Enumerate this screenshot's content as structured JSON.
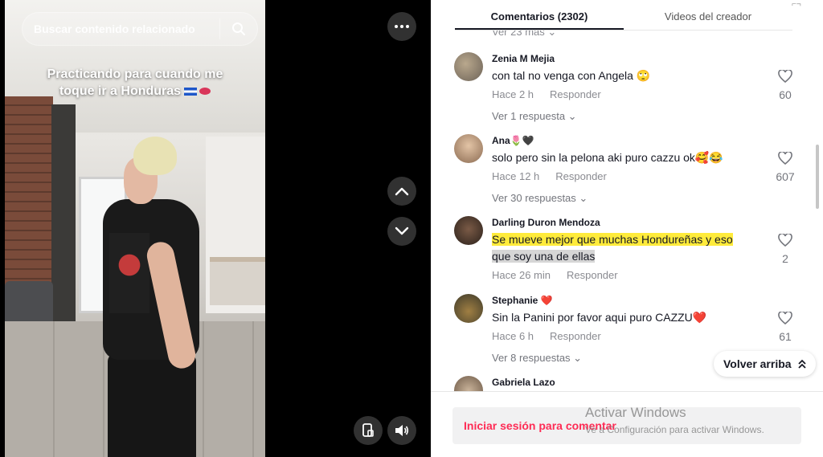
{
  "search": {
    "placeholder": "Buscar contenido relacionado",
    "icon": "search-icon"
  },
  "video": {
    "caption_line1": "Practicando para cuando me",
    "caption_line2": "toque ir a Honduras",
    "emoji": [
      "honduras-flag",
      "lips"
    ]
  },
  "controls": {
    "more": "more-icon",
    "up": "chevron-up-icon",
    "down": "chevron-down-icon",
    "device": "device-icon",
    "volume": "volume-icon"
  },
  "tabs": [
    {
      "label": "Comentarios (2302)",
      "active": true
    },
    {
      "label": "Videos del creador",
      "active": false
    }
  ],
  "partial_prev": "Ver 23 más",
  "comments": [
    {
      "user": "Zenia M Mejia",
      "text": "con tal no venga con Angela 🙄",
      "time": "Hace 2 h",
      "reply": "Responder",
      "likes": "60",
      "replies": "Ver 1 respuesta"
    },
    {
      "user": "Ana🌷🖤",
      "text": "solo pero sin la pelona aki puro cazzu ok🥰😂",
      "time": "Hace 12 h",
      "reply": "Responder",
      "likes": "607",
      "replies": "Ver 30 respuestas"
    },
    {
      "user": "Darling Duron Mendoza",
      "text_highlight": "Se mueve mejor que muchas Hondureñas y eso",
      "text_grey": "que soy una de ellas",
      "time": "Hace 26 min",
      "reply": "Responder",
      "likes": "2"
    },
    {
      "user": "Stephanie ❤️",
      "text": "Sin la Panini por favor aqui puro CAZZU❤️",
      "time": "Hace 6 h",
      "reply": "Responder",
      "likes": "61",
      "replies": "Ver 8 respuestas"
    },
    {
      "user": "Gabriela Lazo"
    }
  ],
  "back_to_top": "Volver arriba",
  "login_prompt": "Iniciar sesión para comentar",
  "windows_watermark": {
    "title": "Activar Windows",
    "subtitle": "Ve a Configuración para activar Windows."
  },
  "colors": {
    "accent": "#fe2c55",
    "text": "#161823",
    "muted": "#8a8b91",
    "highlight": "#ffeb3b"
  }
}
